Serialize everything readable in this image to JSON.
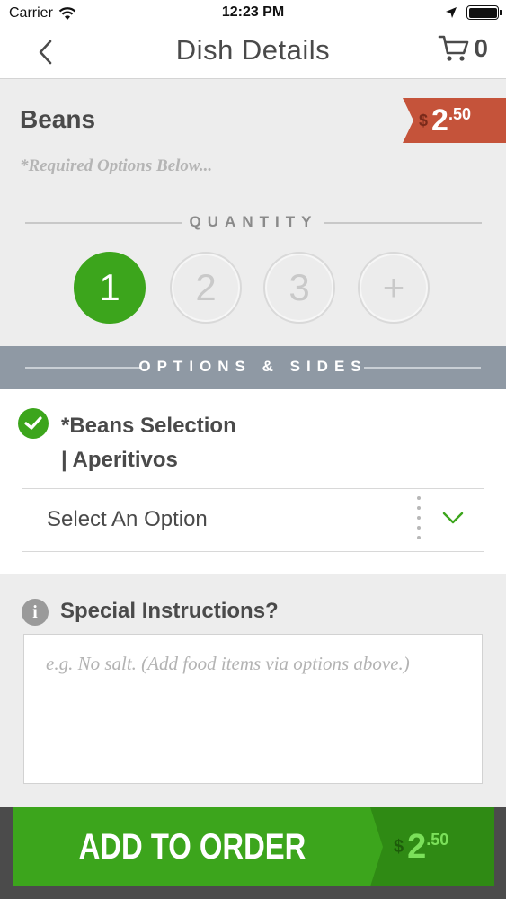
{
  "status_bar": {
    "carrier": "Carrier",
    "time": "12:23 PM"
  },
  "nav": {
    "title": "Dish Details",
    "cart_count": "0"
  },
  "dish": {
    "name": "Beans",
    "required_note": "*Required Options Below...",
    "price_symbol": "$",
    "price_whole": "2",
    "price_cents": ".50"
  },
  "quantity": {
    "label": "QUANTITY",
    "options": [
      "1",
      "2",
      "3",
      "+"
    ],
    "selected": "1"
  },
  "options_band": {
    "label": "OPTIONS & SIDES"
  },
  "option_group": {
    "title_line1": "*Beans Selection",
    "title_line2": "| Aperitivos",
    "select_value": "Select An Option"
  },
  "instructions": {
    "label": "Special Instructions?",
    "placeholder": "e.g. No salt. (Add food items via options above.)"
  },
  "order_button": {
    "label": "ADD TO ORDER",
    "price_symbol": "$",
    "price_whole": "2",
    "price_cents": ".50"
  },
  "colors": {
    "accent_green": "#3ca51c",
    "price_red": "#c5533a",
    "band_gray": "#8f99a4"
  }
}
